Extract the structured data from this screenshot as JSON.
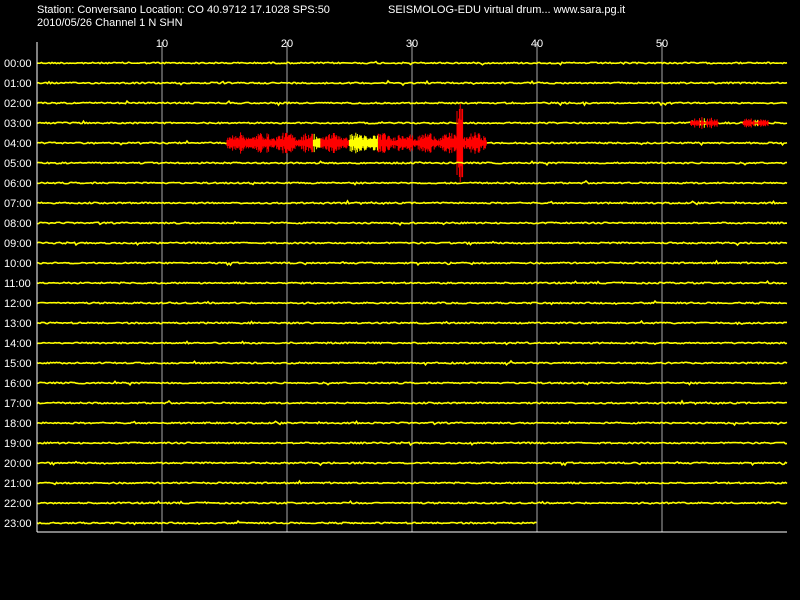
{
  "header": {
    "station_line": "Station: Conversano Location: CO 40.9712 17.1028 SPS:50",
    "date_line": "2010/05/26  Channel 1 N SHN",
    "right_title": "SEISMOLOG-EDU virtual drum... www.sara.pg.it"
  },
  "colors": {
    "background": "#000000",
    "trace": "#ffff00",
    "event": "#ff0000",
    "grid": "#aaaaaa",
    "frame": "#ffffff"
  },
  "chart_data": {
    "type": "line",
    "xlabel": "",
    "ylabel": "",
    "xlim": [
      0,
      60
    ],
    "x_ticks": [
      10,
      20,
      30,
      40,
      50
    ],
    "rows": [
      "00:00",
      "01:00",
      "02:00",
      "03:00",
      "04:00",
      "05:00",
      "06:00",
      "07:00",
      "08:00",
      "09:00",
      "10:00",
      "11:00",
      "12:00",
      "13:00",
      "14:00",
      "15:00",
      "16:00",
      "17:00",
      "18:00",
      "19:00",
      "20:00",
      "21:00",
      "22:00",
      "23:00"
    ],
    "last_row_end_minute": 40,
    "grid": true,
    "events": [
      {
        "row": "03:00",
        "start": 52.3,
        "end": 54.5,
        "amplitude": 0.5
      },
      {
        "row": "03:00",
        "start": 56.5,
        "end": 58.5,
        "amplitude": 0.4
      },
      {
        "row": "04:00",
        "start": 15.2,
        "end": 36.0,
        "amplitude": 0.9
      },
      {
        "row": "04:00",
        "start": 33.6,
        "end": 34.1,
        "amplitude": 4.0
      }
    ]
  }
}
